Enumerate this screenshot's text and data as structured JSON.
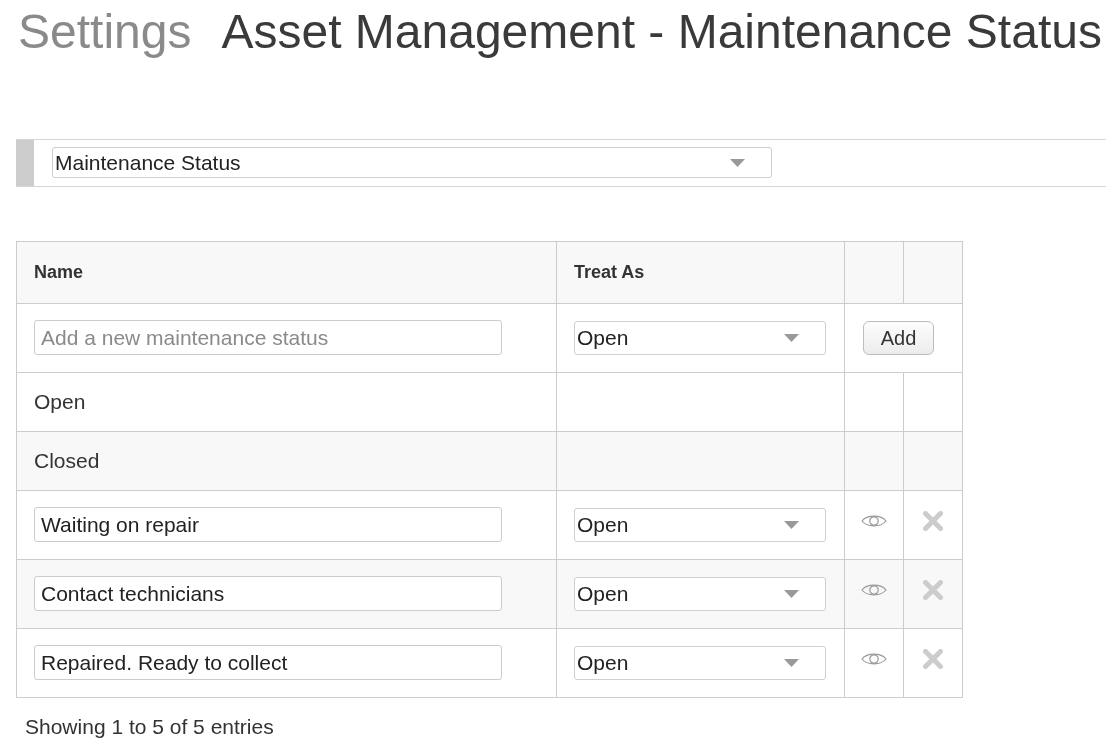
{
  "page": {
    "section": "Settings",
    "title": "Asset Management - Maintenance Status"
  },
  "list_selector": {
    "value": "Maintenance Status"
  },
  "table": {
    "columns": [
      "Name",
      "Treat As"
    ],
    "new_row": {
      "placeholder": "Add a new maintenance status",
      "treat_as": "Open",
      "button": "Add"
    },
    "rows": [
      {
        "kind": "fixed",
        "name": "Open"
      },
      {
        "kind": "fixed",
        "name": "Closed"
      },
      {
        "kind": "editable",
        "name": "Waiting on repair",
        "treat_as": "Open"
      },
      {
        "kind": "editable",
        "name": "Contact technicians",
        "treat_as": "Open"
      },
      {
        "kind": "editable",
        "name": "Repaired. Ready to collect",
        "treat_as": "Open"
      }
    ]
  },
  "footer": {
    "info": "Showing 1 to 5 of 5 entries"
  }
}
